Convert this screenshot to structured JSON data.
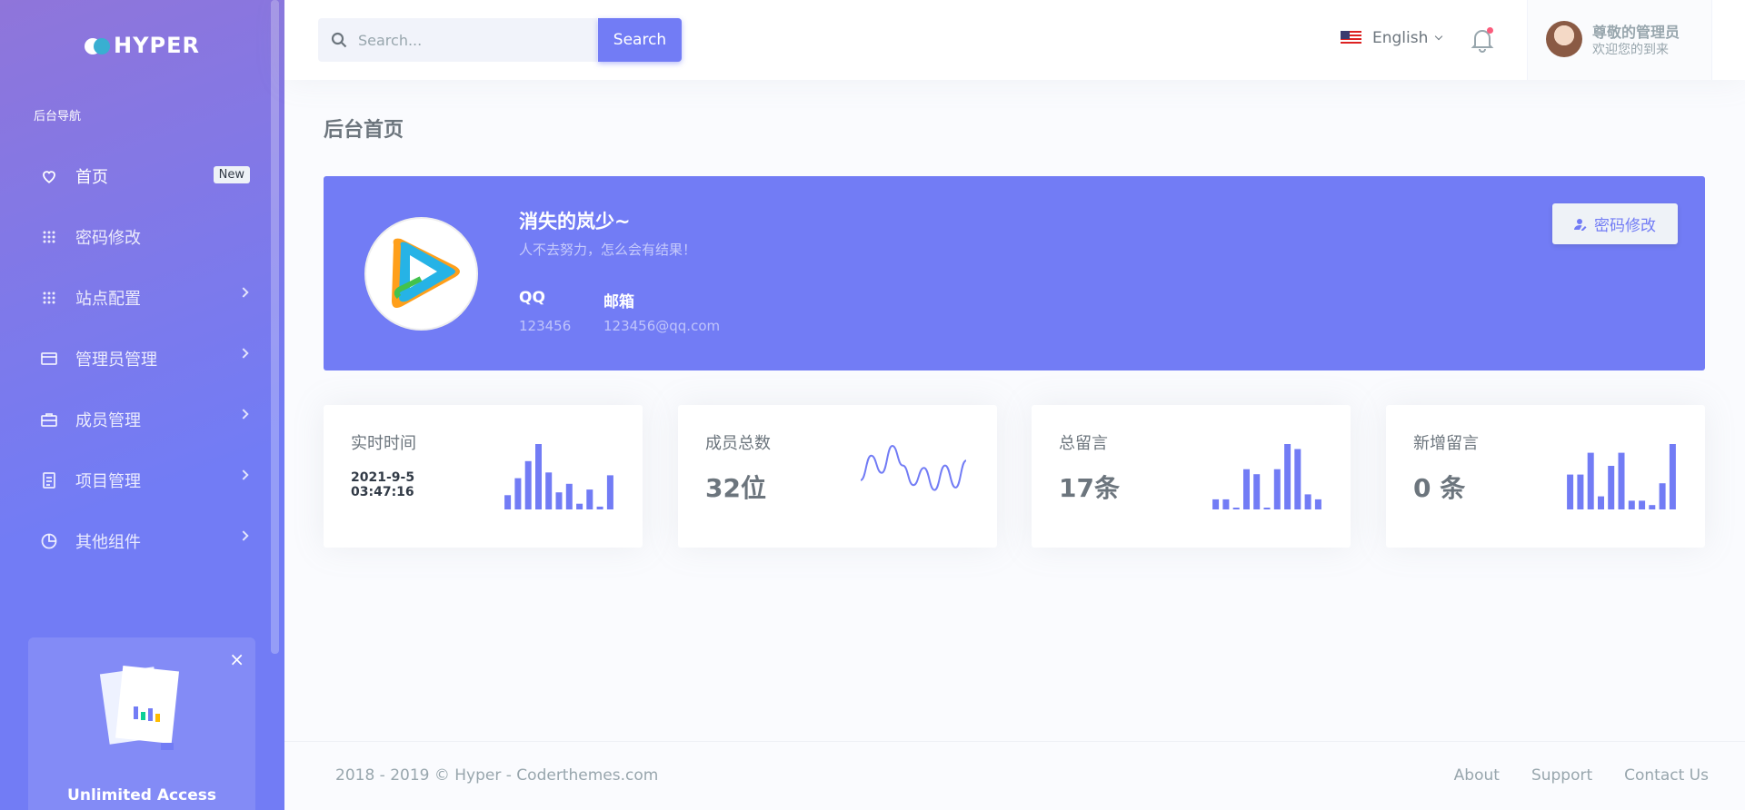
{
  "brand": {
    "name": "HYPER"
  },
  "sidebar": {
    "section_title": "后台导航",
    "items": [
      {
        "label": "首页",
        "icon": "heart-icon",
        "badge": "New",
        "active": true,
        "has_children": false
      },
      {
        "label": "密码修改",
        "icon": "grid-icon",
        "has_children": false
      },
      {
        "label": "站点配置",
        "icon": "grid-icon",
        "has_children": true
      },
      {
        "label": "管理员管理",
        "icon": "window-icon",
        "has_children": true
      },
      {
        "label": "成员管理",
        "icon": "briefcase-icon",
        "has_children": true
      },
      {
        "label": "项目管理",
        "icon": "document-icon",
        "has_children": true
      },
      {
        "label": "其他组件",
        "icon": "pie-chart-icon",
        "has_children": true
      }
    ],
    "promo": {
      "title": "Unlimited Access",
      "close": "×"
    }
  },
  "topbar": {
    "search_placeholder": "Search...",
    "search_button": "Search",
    "language": "English",
    "user": {
      "name": "尊敬的管理员",
      "subtitle": "欢迎您的到来"
    }
  },
  "main": {
    "page_title": "后台首页",
    "profile": {
      "name": "消失的岚少~",
      "motto": "人不去努力，怎么会有结果！",
      "qq_label": "QQ",
      "qq_value": "123456",
      "email_label": "邮箱",
      "email_value": "123456@qq.com",
      "password_button": "密码修改"
    },
    "stats": [
      {
        "label": "实时时间",
        "date": "2021-9-5",
        "time": "03:47:16",
        "chart": "bars",
        "values": [
          5,
          11,
          17,
          23,
          13,
          6,
          9,
          2,
          7,
          1,
          12
        ]
      },
      {
        "label": "成员总数",
        "value": "32位",
        "chart": "line",
        "values": [
          0.3,
          0.8,
          0.45,
          1.0,
          0.6,
          0.2,
          0.55,
          0.1,
          0.6,
          0.15,
          0.7
        ]
      },
      {
        "label": "总留言",
        "value": "17条",
        "chart": "bars",
        "values": [
          2,
          2,
          0,
          8,
          7,
          0,
          8,
          13,
          12,
          3,
          2
        ]
      },
      {
        "label": "新增留言",
        "value": "0 条",
        "chart": "bars",
        "values": [
          8,
          8,
          13,
          3,
          10,
          13,
          2,
          2,
          1,
          6,
          15
        ]
      }
    ]
  },
  "colors": {
    "primary": "#727cf5",
    "sidebar_start": "#8f75da",
    "notification": "#fa5c7c"
  },
  "footer": {
    "copyright": "2018 - 2019 © Hyper - Coderthemes.com",
    "links": [
      "About",
      "Support",
      "Contact Us"
    ]
  }
}
